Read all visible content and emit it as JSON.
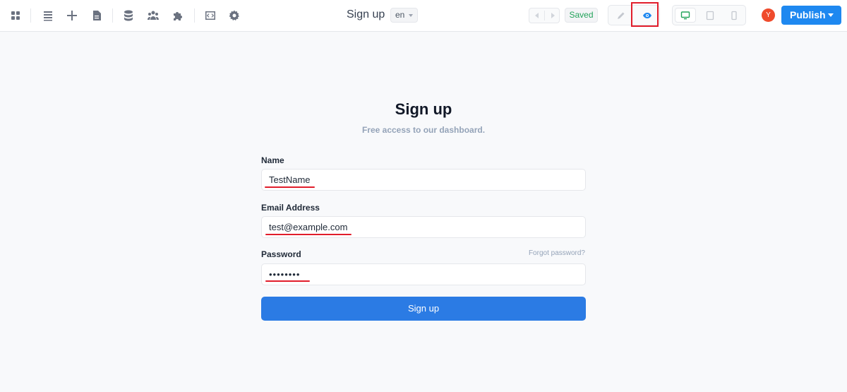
{
  "toolbar": {
    "left_icons": [
      "grid-icon",
      "list-icon",
      "plus-icon",
      "page-icon",
      "database-icon",
      "users-icon",
      "puzzle-icon",
      "code-icon",
      "gear-icon"
    ],
    "page_title": "Sign up",
    "language": "en",
    "saved_label": "Saved",
    "publish_label": "Publish",
    "avatar_initial": "Y",
    "colors": {
      "accent": "#1e88f0",
      "saved": "#22a35a",
      "highlight": "#e11d2b",
      "avatar": "#ef4b2c"
    }
  },
  "form": {
    "title": "Sign up",
    "subtitle": "Free access to our dashboard.",
    "name_label": "Name",
    "name_value": "TestName",
    "email_label": "Email Address",
    "email_value": "test@example.com",
    "password_label": "Password",
    "password_value": "••••••••",
    "forgot_label": "Forgot password?",
    "submit_label": "Sign up",
    "colors": {
      "button": "#2b7be4",
      "annotation": "#e11d2b"
    }
  }
}
